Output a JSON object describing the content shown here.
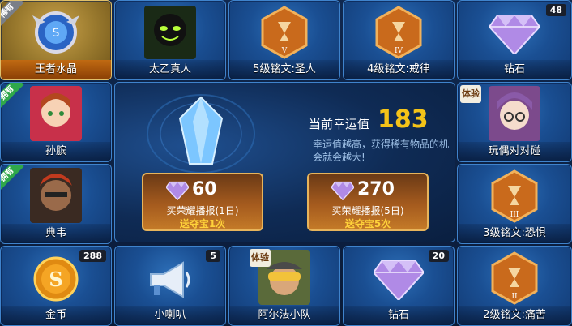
{
  "tiles": {
    "king_crystal": {
      "label": "王者水晶",
      "badge": "稀有"
    },
    "taiyi": {
      "label": "太乙真人"
    },
    "inscription_saint": {
      "label": "5级铭文:圣人",
      "level": "V"
    },
    "inscription_discipline": {
      "label": "4级铭文:戒律",
      "level": "IV"
    },
    "diamond_top": {
      "label": "钻石",
      "count": "48"
    },
    "sunbin": {
      "label": "孙膑",
      "badge": "拥有"
    },
    "doll_collision": {
      "label": "玩偶对对碰",
      "tag": "体验"
    },
    "dianwei": {
      "label": "典韦",
      "badge": "拥有"
    },
    "inscription_fear": {
      "label": "3级铭文:恐惧",
      "level": "III"
    },
    "gold_coin": {
      "label": "金币",
      "count": "288"
    },
    "loudspeaker": {
      "label": "小喇叭",
      "count": "5"
    },
    "alpha_squad": {
      "label": "阿尔法小队",
      "tag": "体验"
    },
    "diamond_bottom": {
      "label": "钻石",
      "count": "20"
    },
    "inscription_pain": {
      "label": "2级铭文:痛苦",
      "level": "II"
    }
  },
  "center": {
    "luck_label": "当前幸运值",
    "luck_value": "183",
    "luck_desc": "幸运值越高，获得稀有物品的机会就会越大!",
    "buy1": {
      "price": "60",
      "name": "买荣耀播报(1日)",
      "sub": "送夺宝1次"
    },
    "buy2": {
      "price": "270",
      "name": "买荣耀播报(5日)",
      "sub": "送夺宝5次"
    }
  },
  "colors": {
    "accent_gold": "#f4c318",
    "tile_blue": "#1a4f93",
    "owned_green": "#2fa84a"
  }
}
